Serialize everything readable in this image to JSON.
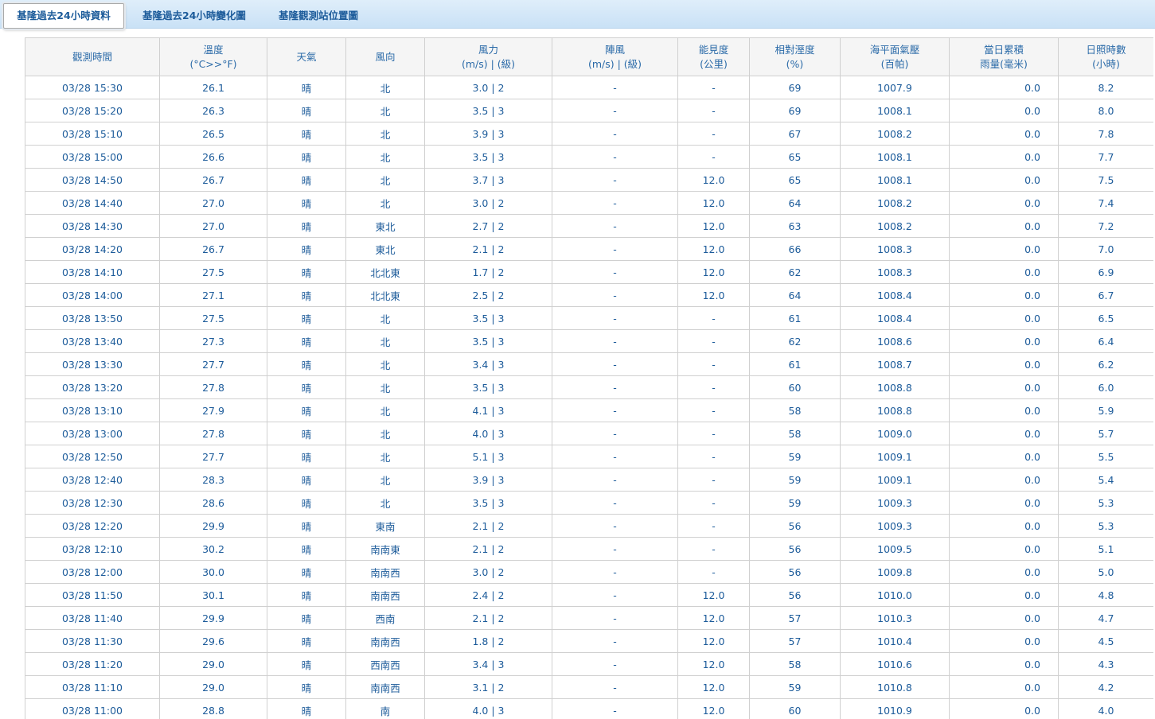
{
  "tabs": [
    {
      "label": "基隆過去24小時資料",
      "active": true
    },
    {
      "label": "基隆過去24小時變化圖",
      "active": false
    },
    {
      "label": "基隆觀測站位置圖",
      "active": false
    }
  ],
  "table": {
    "headers": [
      {
        "line1": "觀測時間",
        "line2": ""
      },
      {
        "line1": "溫度",
        "line2": "(°C>>°F)"
      },
      {
        "line1": "天氣",
        "line2": ""
      },
      {
        "line1": "風向",
        "line2": ""
      },
      {
        "line1": "風力",
        "line2": "(m/s) | (級)"
      },
      {
        "line1": "陣風",
        "line2": "(m/s) | (級)"
      },
      {
        "line1": "能見度",
        "line2": "(公里)"
      },
      {
        "line1": "相對溼度",
        "line2": "(%)"
      },
      {
        "line1": "海平面氣壓",
        "line2": "(百帕)"
      },
      {
        "line1": "當日累積",
        "line2": "雨量(毫米)"
      },
      {
        "line1": "日照時數",
        "line2": "(小時)"
      }
    ],
    "rows": [
      [
        "03/28 15:30",
        "26.1",
        "晴",
        "北",
        "3.0 | 2",
        "-",
        "-",
        "69",
        "1007.9",
        "0.0",
        "8.2"
      ],
      [
        "03/28 15:20",
        "26.3",
        "晴",
        "北",
        "3.5 | 3",
        "-",
        "-",
        "69",
        "1008.1",
        "0.0",
        "8.0"
      ],
      [
        "03/28 15:10",
        "26.5",
        "晴",
        "北",
        "3.9 | 3",
        "-",
        "-",
        "67",
        "1008.2",
        "0.0",
        "7.8"
      ],
      [
        "03/28 15:00",
        "26.6",
        "晴",
        "北",
        "3.5 | 3",
        "-",
        "-",
        "65",
        "1008.1",
        "0.0",
        "7.7"
      ],
      [
        "03/28 14:50",
        "26.7",
        "晴",
        "北",
        "3.7 | 3",
        "-",
        "12.0",
        "65",
        "1008.1",
        "0.0",
        "7.5"
      ],
      [
        "03/28 14:40",
        "27.0",
        "晴",
        "北",
        "3.0 | 2",
        "-",
        "12.0",
        "64",
        "1008.2",
        "0.0",
        "7.4"
      ],
      [
        "03/28 14:30",
        "27.0",
        "晴",
        "東北",
        "2.7 | 2",
        "-",
        "12.0",
        "63",
        "1008.2",
        "0.0",
        "7.2"
      ],
      [
        "03/28 14:20",
        "26.7",
        "晴",
        "東北",
        "2.1 | 2",
        "-",
        "12.0",
        "66",
        "1008.3",
        "0.0",
        "7.0"
      ],
      [
        "03/28 14:10",
        "27.5",
        "晴",
        "北北東",
        "1.7 | 2",
        "-",
        "12.0",
        "62",
        "1008.3",
        "0.0",
        "6.9"
      ],
      [
        "03/28 14:00",
        "27.1",
        "晴",
        "北北東",
        "2.5 | 2",
        "-",
        "12.0",
        "64",
        "1008.4",
        "0.0",
        "6.7"
      ],
      [
        "03/28 13:50",
        "27.5",
        "晴",
        "北",
        "3.5 | 3",
        "-",
        "-",
        "61",
        "1008.4",
        "0.0",
        "6.5"
      ],
      [
        "03/28 13:40",
        "27.3",
        "晴",
        "北",
        "3.5 | 3",
        "-",
        "-",
        "62",
        "1008.6",
        "0.0",
        "6.4"
      ],
      [
        "03/28 13:30",
        "27.7",
        "晴",
        "北",
        "3.4 | 3",
        "-",
        "-",
        "61",
        "1008.7",
        "0.0",
        "6.2"
      ],
      [
        "03/28 13:20",
        "27.8",
        "晴",
        "北",
        "3.5 | 3",
        "-",
        "-",
        "60",
        "1008.8",
        "0.0",
        "6.0"
      ],
      [
        "03/28 13:10",
        "27.9",
        "晴",
        "北",
        "4.1 | 3",
        "-",
        "-",
        "58",
        "1008.8",
        "0.0",
        "5.9"
      ],
      [
        "03/28 13:00",
        "27.8",
        "晴",
        "北",
        "4.0 | 3",
        "-",
        "-",
        "58",
        "1009.0",
        "0.0",
        "5.7"
      ],
      [
        "03/28 12:50",
        "27.7",
        "晴",
        "北",
        "5.1 | 3",
        "-",
        "-",
        "59",
        "1009.1",
        "0.0",
        "5.5"
      ],
      [
        "03/28 12:40",
        "28.3",
        "晴",
        "北",
        "3.9 | 3",
        "-",
        "-",
        "59",
        "1009.1",
        "0.0",
        "5.4"
      ],
      [
        "03/28 12:30",
        "28.6",
        "晴",
        "北",
        "3.5 | 3",
        "-",
        "-",
        "59",
        "1009.3",
        "0.0",
        "5.3"
      ],
      [
        "03/28 12:20",
        "29.9",
        "晴",
        "東南",
        "2.1 | 2",
        "-",
        "-",
        "56",
        "1009.3",
        "0.0",
        "5.3"
      ],
      [
        "03/28 12:10",
        "30.2",
        "晴",
        "南南東",
        "2.1 | 2",
        "-",
        "-",
        "56",
        "1009.5",
        "0.0",
        "5.1"
      ],
      [
        "03/28 12:00",
        "30.0",
        "晴",
        "南南西",
        "3.0 | 2",
        "-",
        "-",
        "56",
        "1009.8",
        "0.0",
        "5.0"
      ],
      [
        "03/28 11:50",
        "30.1",
        "晴",
        "南南西",
        "2.4 | 2",
        "-",
        "12.0",
        "56",
        "1010.0",
        "0.0",
        "4.8"
      ],
      [
        "03/28 11:40",
        "29.9",
        "晴",
        "西南",
        "2.1 | 2",
        "-",
        "12.0",
        "57",
        "1010.3",
        "0.0",
        "4.7"
      ],
      [
        "03/28 11:30",
        "29.6",
        "晴",
        "南南西",
        "1.8 | 2",
        "-",
        "12.0",
        "57",
        "1010.4",
        "0.0",
        "4.5"
      ],
      [
        "03/28 11:20",
        "29.0",
        "晴",
        "西南西",
        "3.4 | 3",
        "-",
        "12.0",
        "58",
        "1010.6",
        "0.0",
        "4.3"
      ],
      [
        "03/28 11:10",
        "29.0",
        "晴",
        "南南西",
        "3.1 | 2",
        "-",
        "12.0",
        "59",
        "1010.8",
        "0.0",
        "4.2"
      ],
      [
        "03/28 11:00",
        "28.8",
        "晴",
        "南",
        "4.0 | 3",
        "-",
        "12.0",
        "60",
        "1010.9",
        "0.0",
        "4.0"
      ]
    ]
  },
  "colors": {
    "link": "#1c5b9a",
    "header_text": "#2a6aa8",
    "tabbar_bg": "#c9e1f6",
    "grid": "#d0d0d0"
  }
}
